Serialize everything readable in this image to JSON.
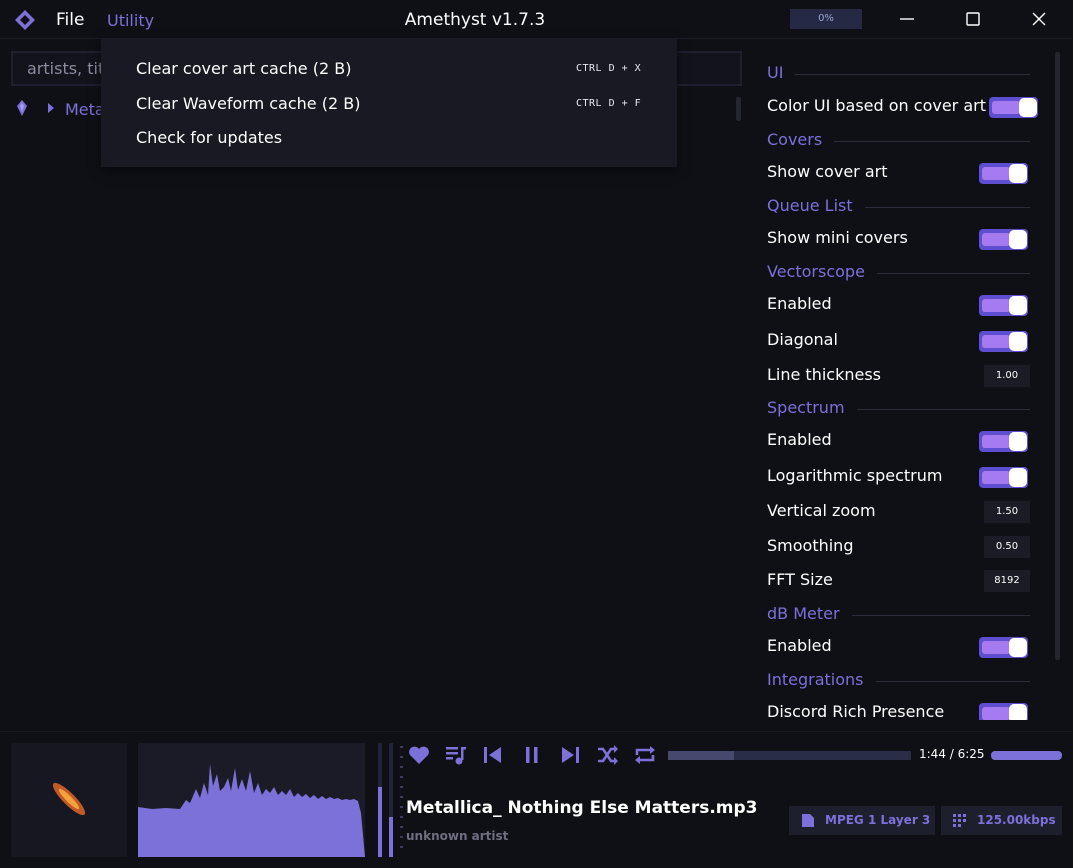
{
  "titlebar": {
    "title": "Amethyst v1.7.3",
    "menu_file": "File",
    "menu_utility": "Utility",
    "progress_label": "0%",
    "icons": [
      "amethyst-logo-icon",
      "minimize-icon",
      "maximize-icon",
      "close-icon"
    ]
  },
  "library": {
    "search_placeholder": "artists, title",
    "tree_item_label": "Meta"
  },
  "utility_menu": {
    "items": [
      {
        "label": "Clear cover art cache (2 B)",
        "shortcut": "CTRL D + X"
      },
      {
        "label": "Clear Waveform cache (2 B)",
        "shortcut": "CTRL D + F"
      },
      {
        "label": "Check for updates",
        "shortcut": ""
      }
    ]
  },
  "settings": {
    "sections": {
      "ui": "UI",
      "covers": "Covers",
      "queue": "Queue List",
      "vectorscope": "Vectorscope",
      "spectrum": "Spectrum",
      "dbmeter": "dB Meter",
      "integrations": "Integrations"
    },
    "rows": {
      "color_ui": {
        "label": "Color UI based on cover art",
        "on": true
      },
      "show_cover_art": {
        "label": "Show cover art",
        "on": true
      },
      "show_mini_covers": {
        "label": "Show mini covers",
        "on": true
      },
      "vs_enabled": {
        "label": "Enabled",
        "on": true
      },
      "vs_diagonal": {
        "label": "Diagonal",
        "on": true
      },
      "vs_line_thickness": {
        "label": "Line thickness",
        "value": "1.00"
      },
      "sp_enabled": {
        "label": "Enabled",
        "on": true
      },
      "sp_log": {
        "label": "Logarithmic spectrum",
        "on": true
      },
      "sp_vzoom": {
        "label": "Vertical zoom",
        "value": "1.50"
      },
      "sp_smoothing": {
        "label": "Smoothing",
        "value": "0.50"
      },
      "sp_fft": {
        "label": "FFT Size",
        "value": "8192"
      },
      "db_enabled": {
        "label": "Enabled",
        "on": true
      },
      "discord": {
        "label": "Discord Rich Presence",
        "on": true
      }
    }
  },
  "player": {
    "track_title": "Metallica_ Nothing Else Matters.mp3",
    "artist": "unknown artist",
    "time": "1:44 / 6:25",
    "seek_progress": 0.27,
    "volume_level": 1.0,
    "format_badge": "MPEG 1 Layer 3",
    "bitrate_badge": "125.00kbps",
    "controls": [
      "heart-icon",
      "queue-music-icon",
      "skip-previous-icon",
      "pause-icon",
      "skip-next-icon",
      "shuffle-icon",
      "repeat-icon"
    ]
  },
  "colors": {
    "accent": "#7b71d8",
    "background": "#0f1016",
    "panel": "#181922",
    "toggle_track": "#8d6ef0",
    "toggle_knob": "#ffffff"
  }
}
